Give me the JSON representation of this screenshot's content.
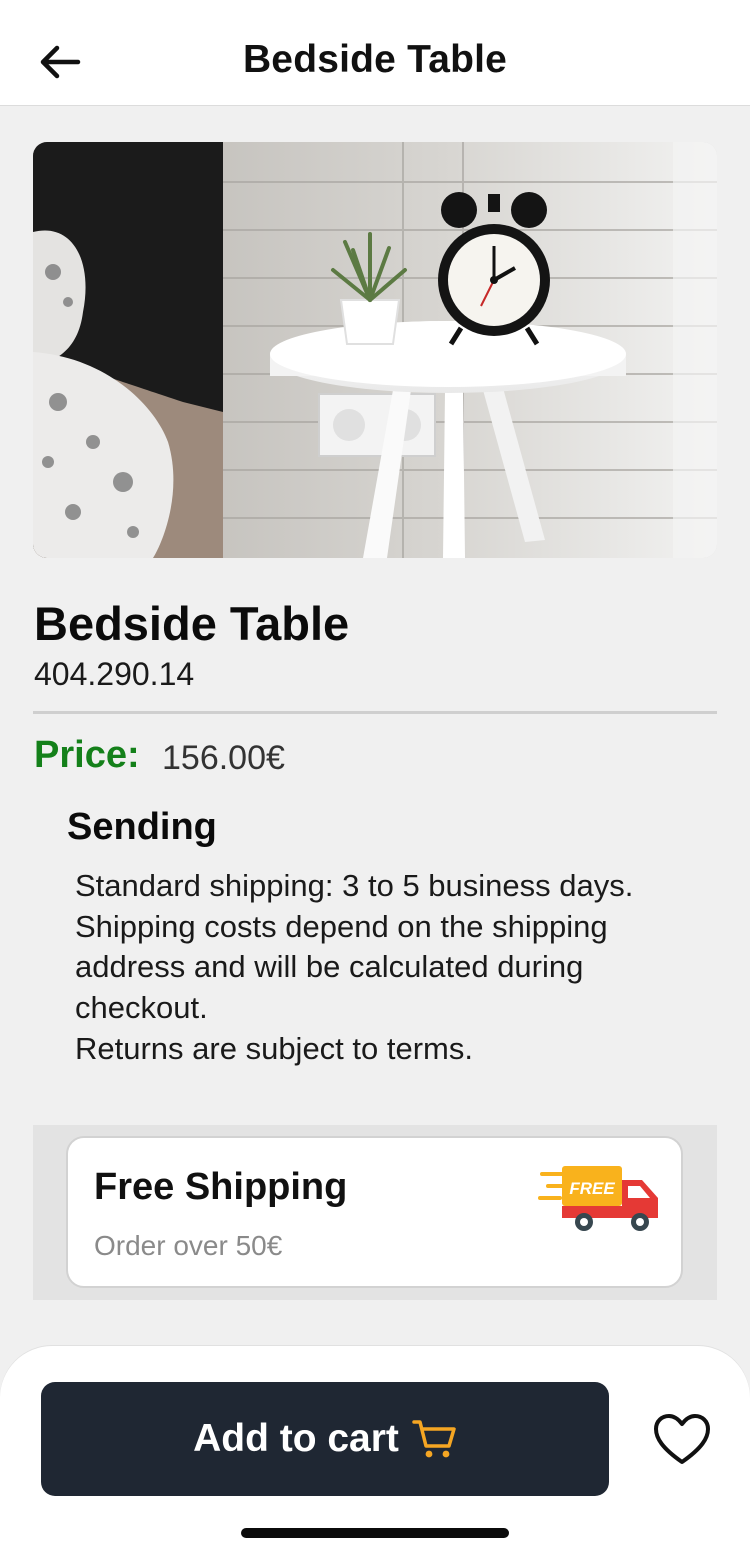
{
  "header": {
    "title": "Bedside Table",
    "back_icon": "arrow-left-icon"
  },
  "product": {
    "name": "Bedside Table",
    "code": "404.290.14",
    "price_label": "Price:",
    "price_value": "156.00€"
  },
  "sending": {
    "title": "Sending",
    "lines": [
      "Standard shipping: 3 to 5 business days.",
      "Shipping costs depend on the shipping address and will be calculated during checkout.",
      "Returns are subject to terms."
    ]
  },
  "promo": {
    "title": "Free Shipping",
    "subtitle": "Order over 50€",
    "truck_badge": "FREE",
    "icon": "delivery-truck-icon"
  },
  "actions": {
    "add_to_cart_label": "Add to cart",
    "cart_icon": "shopping-cart-icon",
    "favorite_icon": "heart-icon"
  },
  "colors": {
    "price_green": "#14801a",
    "button_dark": "#1f2733",
    "cart_icon_orange": "#f5a623",
    "truck_red": "#e53935",
    "truck_yellow": "#f9b21c"
  }
}
